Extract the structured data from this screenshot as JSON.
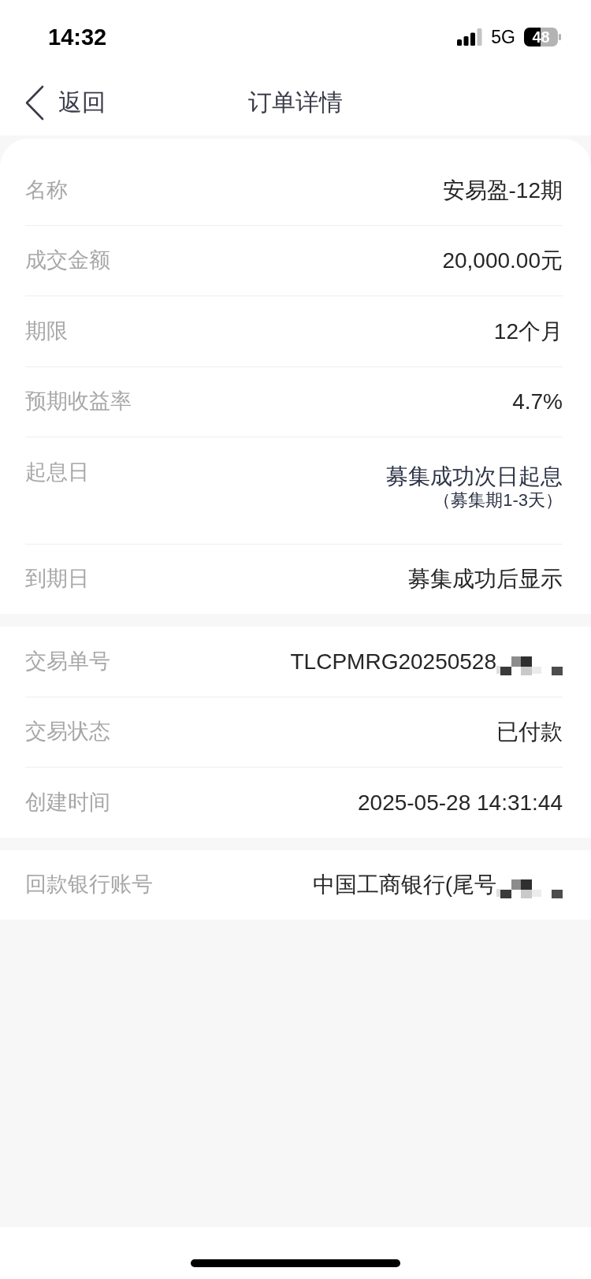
{
  "status_bar": {
    "time": "14:32",
    "network": "5G",
    "battery": "48"
  },
  "nav_bar": {
    "back": "返回",
    "title": "订单详情"
  },
  "sections": [
    {
      "rows": [
        {
          "label": "名称",
          "value": "安易盈-12期",
          "redacted": false
        },
        {
          "label": "成交金额",
          "value": "20,000.00元",
          "redacted": false
        },
        {
          "label": "期限",
          "value": "12个月",
          "redacted": false
        },
        {
          "label": "预期收益率",
          "value": "4.7%",
          "redacted": false
        },
        {
          "label": "起息日",
          "value": "募集成功次日起息",
          "note": "（募集期1-3天）",
          "redacted": false
        },
        {
          "label": "到期日",
          "value": "募集成功后显示",
          "redacted": false
        }
      ]
    },
    {
      "rows": [
        {
          "label": "交易单号",
          "value": "TLCPMRG20250528",
          "redacted": true
        },
        {
          "label": "交易状态",
          "value": "已付款",
          "redacted": false
        },
        {
          "label": "创建时间",
          "value": "2025-05-28 14:31:44",
          "redacted": false
        }
      ]
    },
    {
      "rows": [
        {
          "label": "回款银行账号",
          "value": "中国工商银行(尾号",
          "redacted": true
        }
      ]
    }
  ]
}
